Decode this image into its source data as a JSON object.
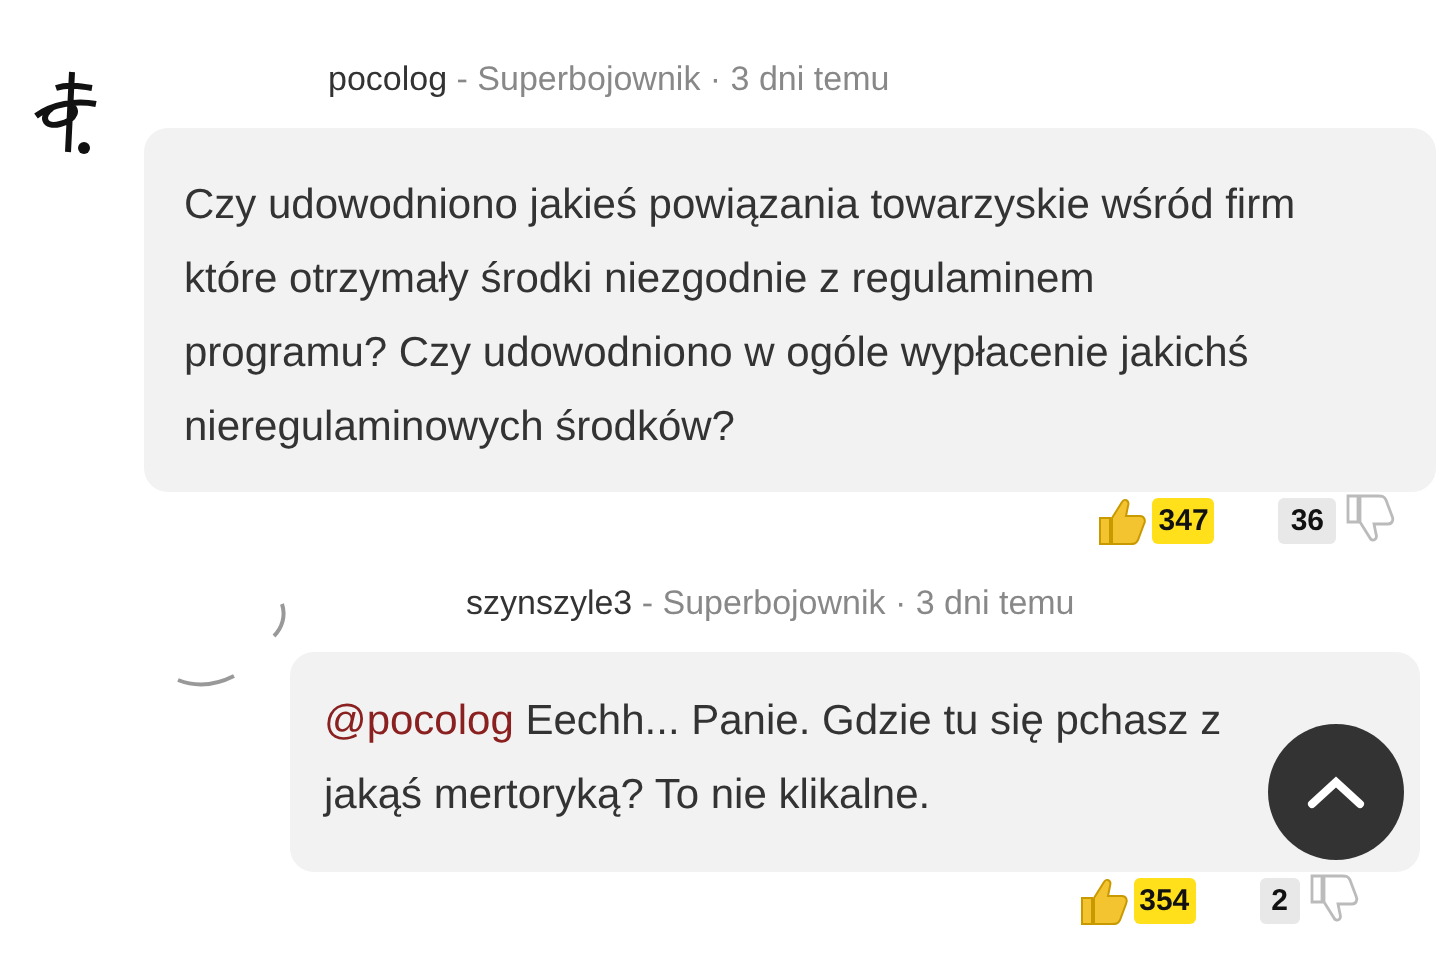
{
  "comments": [
    {
      "author": "pocolog",
      "meta": "- Superbojownik · 3 dni temu",
      "text": "Czy udowodniono jakieś powiązania towarzyskie wśród firm które otrzymały środki niezgodnie z regulaminem programu? Czy udowodniono w ogóle wypłacenie jakichś nieregulaminowych środków?",
      "likes": "347",
      "dislikes": "36"
    },
    {
      "author": "szynszyle3",
      "meta": "- Superbojownik · 3 dni temu",
      "mention": "@pocolog",
      "text": "Eechh... Panie. Gdzie tu się pchasz z jakąś mertoryką? To nie klikalne.",
      "likes": "354",
      "dislikes": "2"
    }
  ]
}
